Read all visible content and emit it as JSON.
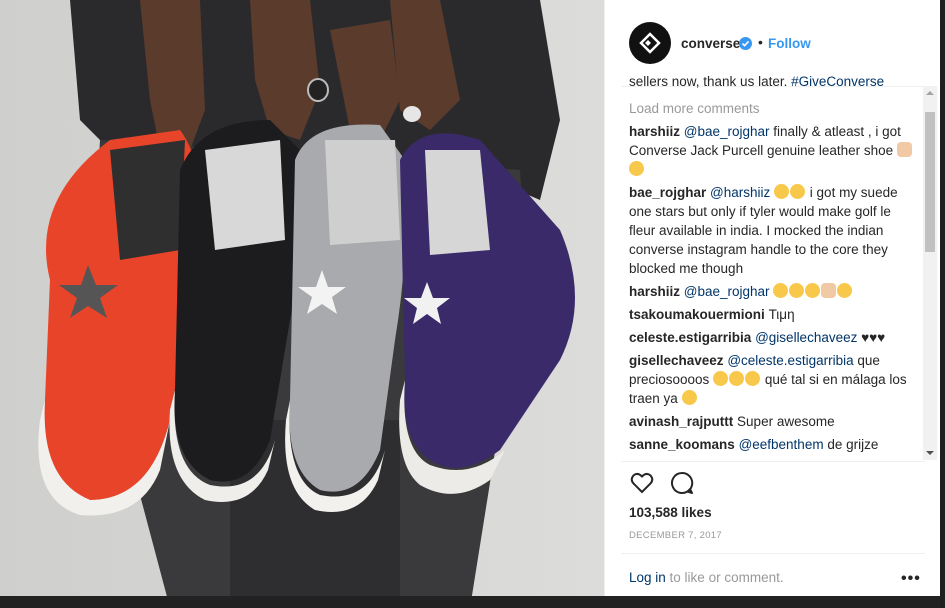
{
  "post": {
    "username": "converse",
    "follow_label": "Follow",
    "separator": "•"
  },
  "caption_tail": {
    "text": "sellers now, thank us later. ",
    "hashtag": "#GiveConverse"
  },
  "load_more": "Load more comments",
  "comments": [
    {
      "user": "harshiiz",
      "mention": "@bae_rojghar",
      "text": " finally & atleast , i got Converse Jack Purcell genuine leather shoe",
      "emojis": [
        "hand",
        "face"
      ]
    },
    {
      "user": "bae_rojghar",
      "mention": "@harshiiz",
      "emojis_before": [
        "face",
        "face"
      ],
      "text": " i got my suede one stars but only if tyler would make golf le fleur available in india. I mocked the indian converse instagram handle to the core they blocked me though"
    },
    {
      "user": "harshiiz",
      "mention": "@bae_rojghar",
      "text": "",
      "emojis": [
        "face",
        "face",
        "face",
        "hand",
        "face"
      ]
    },
    {
      "user": "tsakoumakouermioni",
      "mention": "",
      "text": "Τιμη"
    },
    {
      "user": "celeste.estigarribia",
      "mention": "@gisellechaveez",
      "text": " ♥♥♥"
    },
    {
      "user": "gisellechaveez",
      "mention": "@celeste.estigarribia",
      "text": " que preciosoooos",
      "emojis": [
        "face",
        "face",
        "face"
      ],
      "text_after": " qué tal si en málaga los traen ya",
      "emojis_after": [
        "face"
      ]
    },
    {
      "user": "avinash_rajputtt",
      "mention": "",
      "text": "Super awesome"
    },
    {
      "user": "sanne_koomans",
      "mention": "@eefbenthem",
      "text": " de grijze"
    }
  ],
  "likes": "103,588 likes",
  "date": "DECEMBER 7, 2017",
  "login": {
    "link": "Log in",
    "rest": " to like or comment."
  },
  "more_options": "•••",
  "icons": {
    "like": "heart-icon",
    "comment": "comment-icon",
    "verified": "verified-badge-icon",
    "logo": "converse-star-chevron-logo"
  },
  "colors": {
    "link_blue": "#3897f0",
    "mention_navy": "#003569",
    "muted_gray": "#999999",
    "shoe_red": "#e8442a",
    "shoe_black": "#1c1c1e",
    "shoe_gray": "#a9aaad",
    "shoe_purple": "#3a2a6a"
  }
}
